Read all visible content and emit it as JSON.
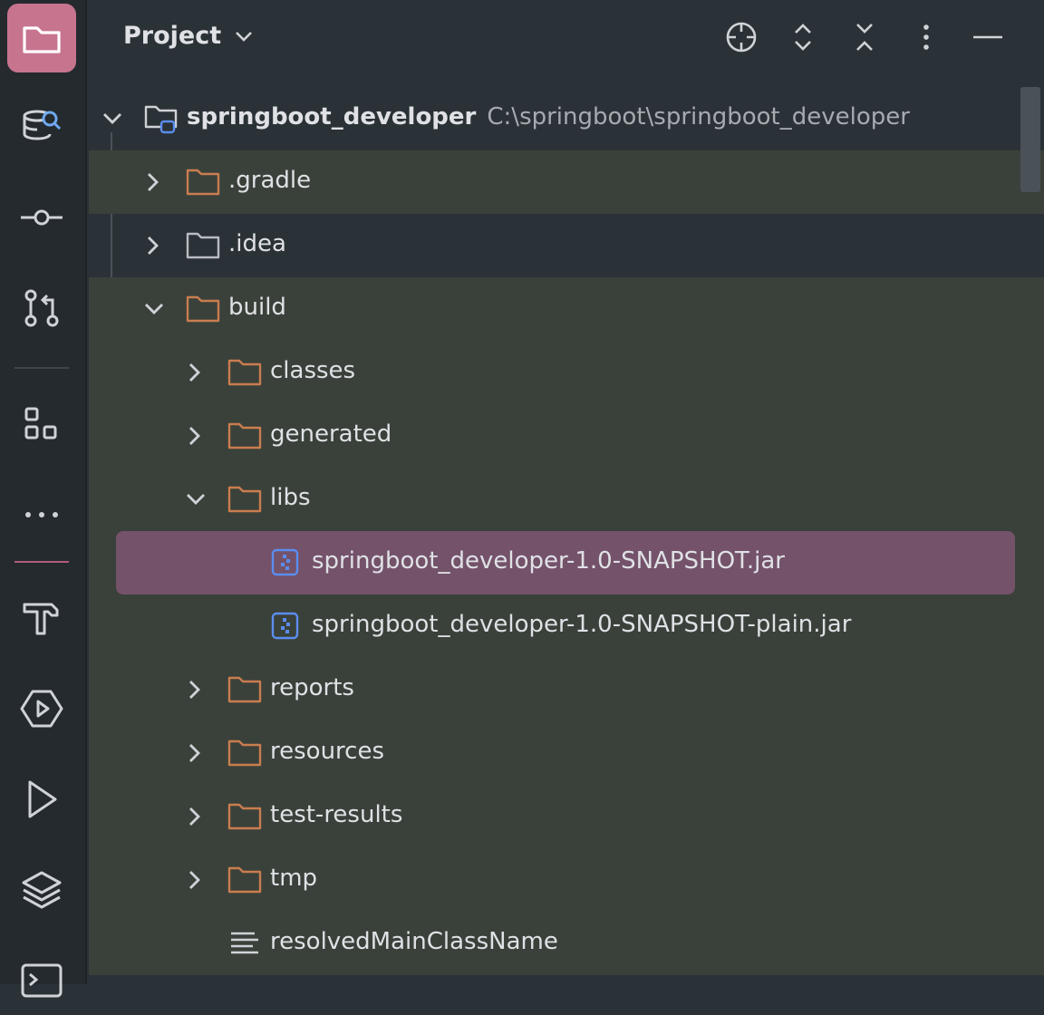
{
  "header": {
    "title": "Project"
  },
  "colors": {
    "accent": "#c7748f",
    "folder": "#c97d4f",
    "jar": "#5b8def",
    "selection": "#74526a"
  },
  "rail": {
    "icons": [
      "folder-icon",
      "database-search-icon",
      "commit-icon",
      "pull-request-icon",
      "structure-icon",
      "more-icon",
      "build-hammer-icon",
      "services-icon",
      "run-icon",
      "layers-icon",
      "terminal-icon"
    ]
  },
  "tree": {
    "root": {
      "name": "springboot_developer",
      "path": "C:\\springboot\\springboot_developer"
    },
    "items": [
      {
        "label": ".gradle"
      },
      {
        "label": ".idea"
      },
      {
        "label": "build"
      },
      {
        "label": "classes"
      },
      {
        "label": "generated"
      },
      {
        "label": "libs"
      },
      {
        "label": "springboot_developer-1.0-SNAPSHOT.jar"
      },
      {
        "label": "springboot_developer-1.0-SNAPSHOT-plain.jar"
      },
      {
        "label": "reports"
      },
      {
        "label": "resources"
      },
      {
        "label": "test-results"
      },
      {
        "label": "tmp"
      },
      {
        "label": "resolvedMainClassName"
      }
    ]
  }
}
